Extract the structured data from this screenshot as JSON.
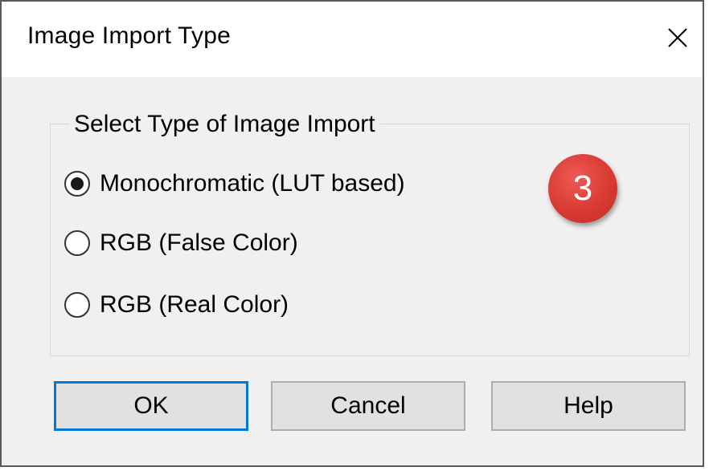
{
  "dialog": {
    "title": "Image Import Type",
    "close_icon": "close-icon"
  },
  "group": {
    "legend": "Select Type of Image Import",
    "options": [
      {
        "label": "Monochromatic (LUT based)",
        "selected": true
      },
      {
        "label": "RGB (False Color)",
        "selected": false
      },
      {
        "label": "RGB (Real Color)",
        "selected": false
      }
    ]
  },
  "badge": {
    "text": "3",
    "color": "#d93a34"
  },
  "buttons": {
    "ok": "OK",
    "cancel": "Cancel",
    "help": "Help"
  },
  "colors": {
    "focus_border": "#0078d7",
    "dialog_bg": "#f0f0f0"
  }
}
